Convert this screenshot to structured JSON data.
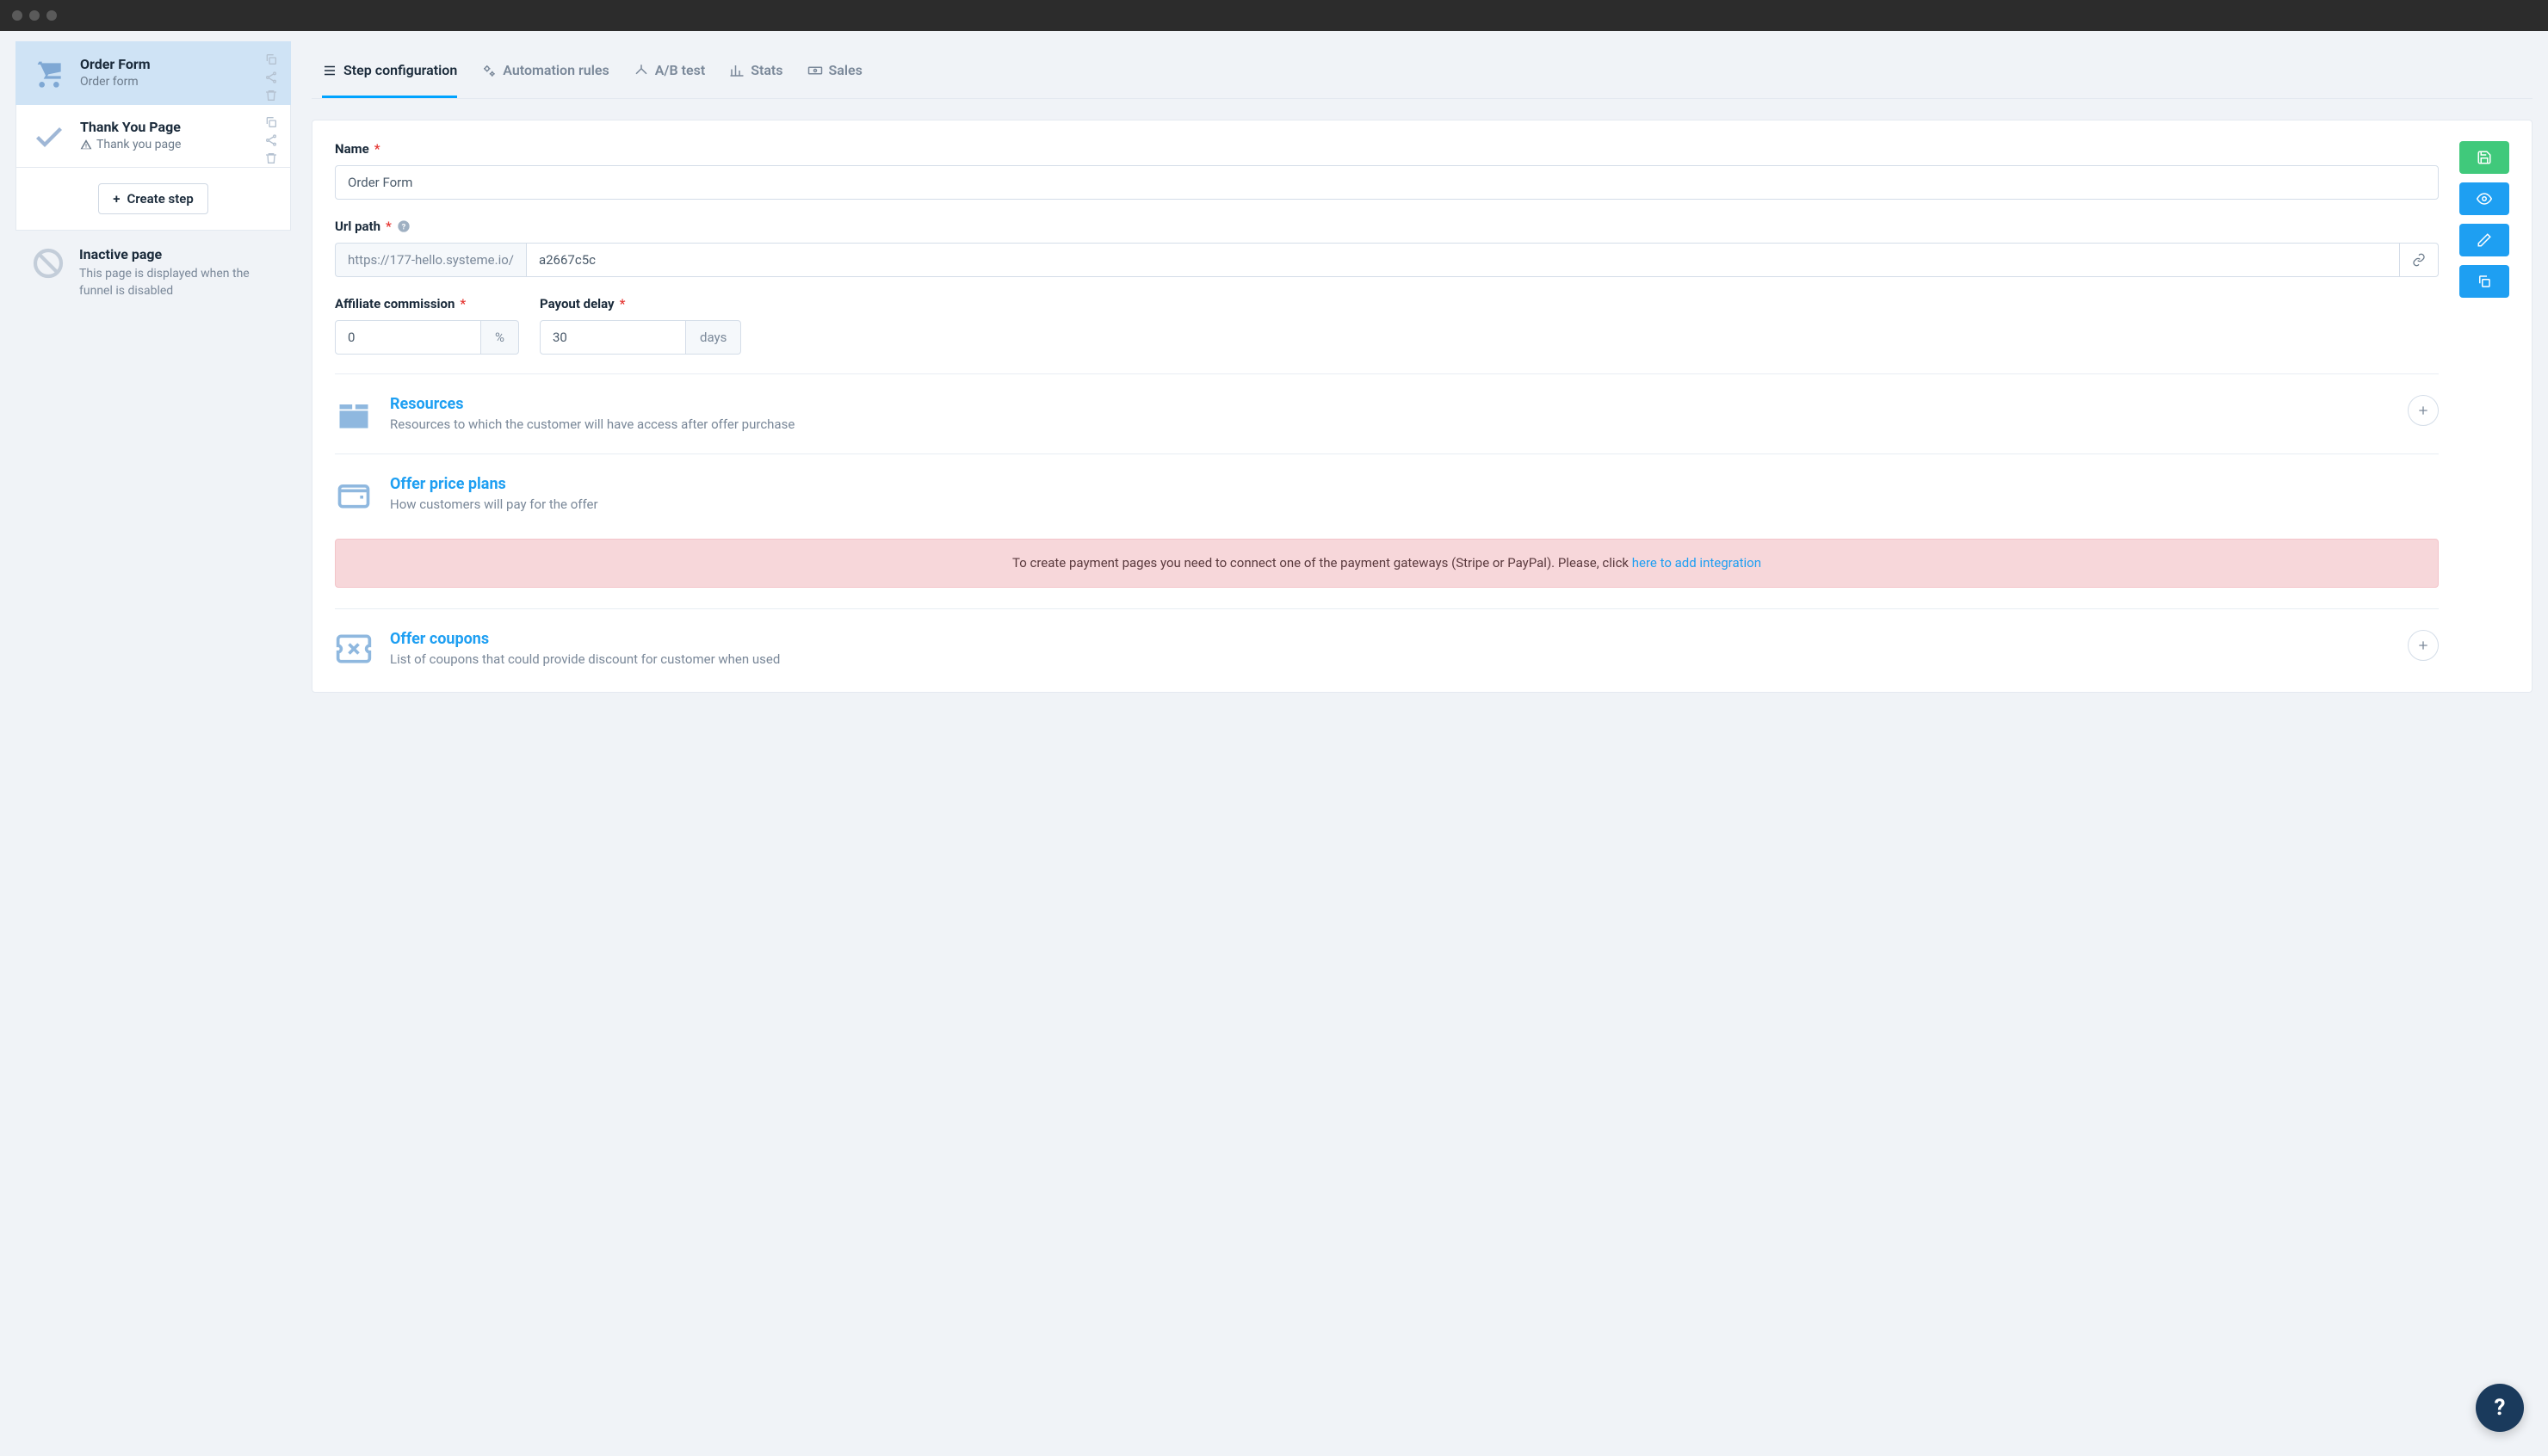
{
  "sidebar": {
    "steps": [
      {
        "title": "Order Form",
        "subtitle": "Order form"
      },
      {
        "title": "Thank You Page",
        "subtitle": "Thank you page"
      }
    ],
    "create_step": "Create step",
    "inactive": {
      "title": "Inactive page",
      "desc": "This page is displayed when the funnel is disabled"
    }
  },
  "tabs": {
    "step_config": "Step configuration",
    "automation": "Automation rules",
    "abtest": "A/B test",
    "stats": "Stats",
    "sales": "Sales"
  },
  "form": {
    "name_label": "Name",
    "name_value": "Order Form",
    "url_label": "Url path",
    "url_prefix": "https://177-hello.systeme.io/",
    "url_value": "a2667c5c",
    "commission_label": "Affiliate commission",
    "commission_value": "0",
    "commission_suffix": "%",
    "payout_label": "Payout delay",
    "payout_value": "30",
    "payout_suffix": "days"
  },
  "sections": {
    "resources": {
      "title": "Resources",
      "desc": "Resources to which the customer will have access after offer purchase"
    },
    "price": {
      "title": "Offer price plans",
      "desc": "How customers will pay for the offer"
    },
    "alert_text": "To create payment pages you need to connect one of the payment gateways (Stripe or PayPal). Please, click ",
    "alert_link": "here to add integration",
    "coupons": {
      "title": "Offer coupons",
      "desc": "List of coupons that could provide discount for customer when used"
    }
  },
  "help": "?"
}
